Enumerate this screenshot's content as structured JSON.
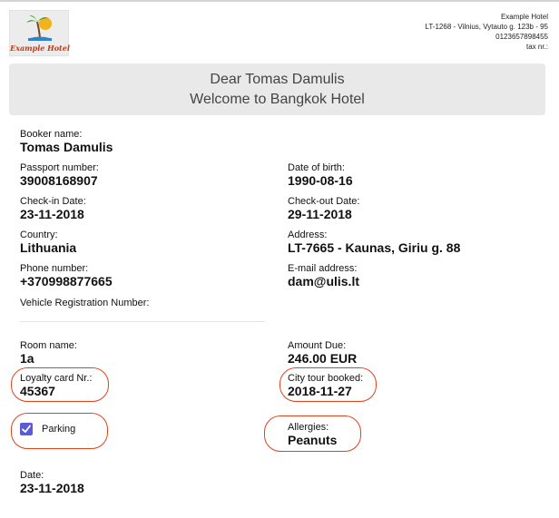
{
  "logo": {
    "text": "Example Hotel",
    "icon": "palm-sun-logo-icon"
  },
  "company": {
    "name": "Example Hotel",
    "code_address": "LT-1268 - Vilnius, Vytauto g. 123b - 95",
    "phone": "0123657898455",
    "tax": "tax nr.:"
  },
  "welcome": {
    "line1": "Dear Tomas Damulis",
    "line2": "Welcome to Bangkok Hotel"
  },
  "fields": {
    "booker": {
      "label": "Booker name:",
      "value": "Tomas Damulis"
    },
    "passport": {
      "label": "Passport number:",
      "value": "39008168907"
    },
    "dob": {
      "label": "Date of birth:",
      "value": "1990-08-16"
    },
    "checkin": {
      "label": "Check-in Date:",
      "value": "23-11-2018"
    },
    "checkout": {
      "label": "Check-out Date:",
      "value": "29-11-2018"
    },
    "country": {
      "label": "Country:",
      "value": "Lithuania"
    },
    "address": {
      "label": "Address:",
      "value": "LT-7665 - Kaunas, Giriu g. 88"
    },
    "phone": {
      "label": "Phone number:",
      "value": "+370998877665"
    },
    "email": {
      "label": "E-mail address:",
      "value": "dam@ulis.lt"
    },
    "vehicle": {
      "label": "Vehicle Registration Number:"
    },
    "room": {
      "label": "Room name:",
      "value": "1a"
    },
    "amount": {
      "label": "Amount Due:",
      "value": "246.00 EUR"
    },
    "loyalty": {
      "label": "Loyalty card Nr.:",
      "value": "45367"
    },
    "citytour": {
      "label": "City tour booked:",
      "value": "2018-11-27"
    },
    "parking": {
      "label": "Parking",
      "checked": true
    },
    "allergies": {
      "label": "Allergies:",
      "value": "Peanuts"
    },
    "date": {
      "label": "Date:",
      "value": "23-11-2018"
    }
  },
  "colors": {
    "checkbox": "#5b5bd6",
    "annotation": "#e0431c",
    "logo_text": "#c23b12"
  }
}
